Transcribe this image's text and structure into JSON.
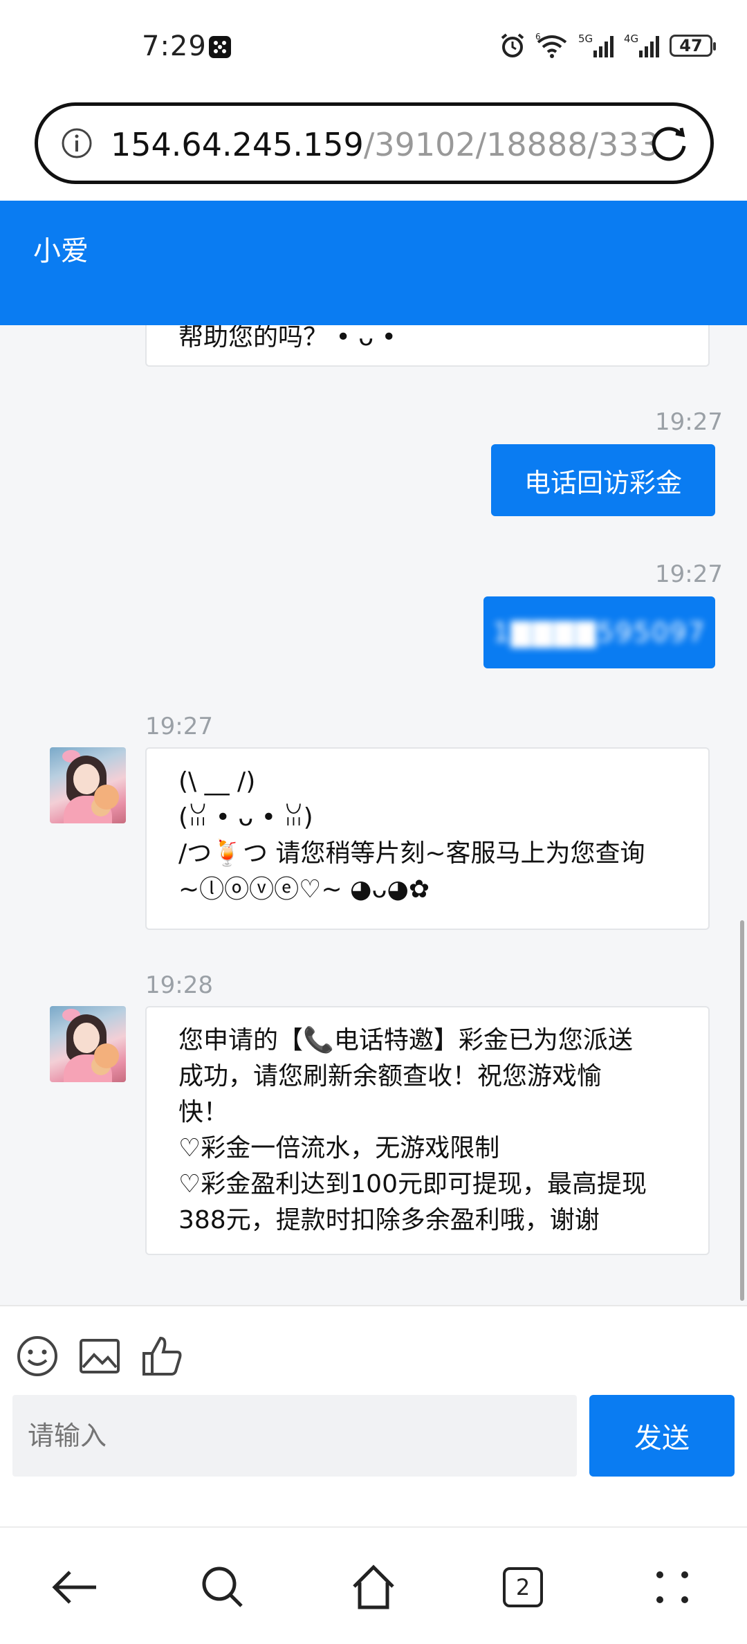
{
  "status_bar": {
    "time": "7:29",
    "network_5g": "5G",
    "network_4g": "4G",
    "wifi_label": "6",
    "battery": "47"
  },
  "url_bar": {
    "host": "154.64.245.159",
    "path": "/39102/18888/333"
  },
  "chat": {
    "title": "小爱",
    "messages": [
      {
        "type": "in",
        "partial_text": "帮助您的吗？ • ᴗ •"
      },
      {
        "type": "out",
        "time": "19:27",
        "text": "电话回访彩金"
      },
      {
        "type": "out",
        "time": "19:27",
        "text": "1▇▇▇▇595097"
      },
      {
        "type": "in",
        "time": "19:27",
        "lines": [
          "(\\ __ /)",
          "(ꈍ • ᴗ • ꈍ)",
          "/つ🍹つ 请您稍等片刻~客服马上为您查询",
          "~ⓛⓞⓥⓔ♡~ ◕ᴗ◕✿"
        ]
      },
      {
        "type": "in",
        "time": "19:28",
        "lines": [
          "您申请的【📞电话特邀】彩金已为您派送",
          "成功，请您刷新余额查收！祝您游戏愉",
          "快！",
          "♡彩金一倍流水，无游戏限制",
          "♡彩金盈利达到100元即可提现，最高提现",
          "388元，提款时扣除多余盈利哦，谢谢"
        ]
      }
    ]
  },
  "composer": {
    "placeholder": "请输入",
    "send_label": "发送",
    "tools": [
      "emoji-icon",
      "image-icon",
      "thumbs-up-icon"
    ]
  },
  "nav": {
    "tabs_count": "2",
    "icons": [
      "back-arrow-icon",
      "search-icon",
      "home-icon",
      "tabs-icon",
      "more-icon"
    ]
  },
  "colors": {
    "accent": "#0a7cf2",
    "chat_bg": "#f5f6f8"
  }
}
